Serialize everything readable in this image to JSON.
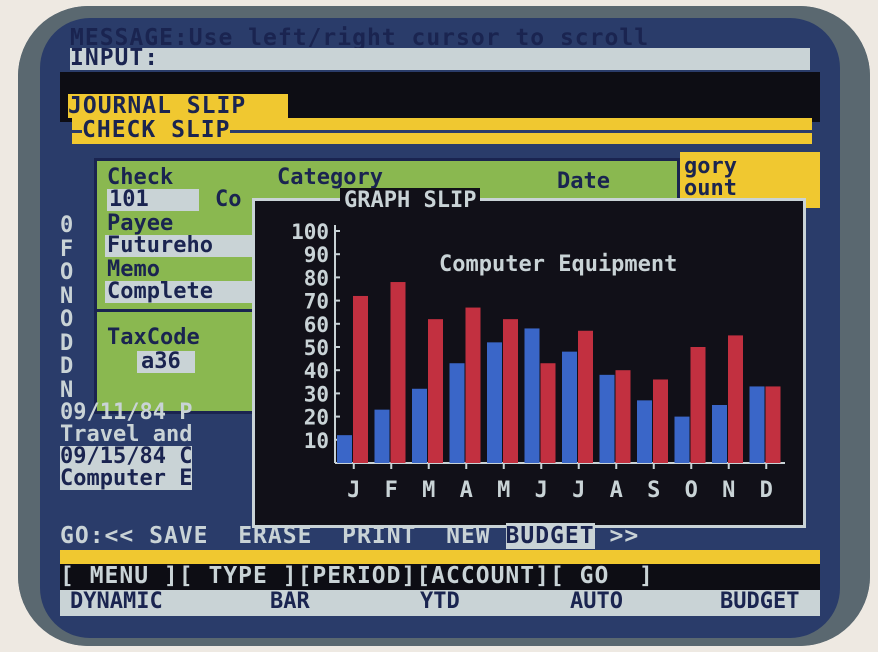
{
  "message": {
    "label": "MESSAGE:",
    "text": "Use left/right cursor to scroll"
  },
  "input": {
    "label": "INPUT:"
  },
  "journal_slip": "JOURNAL SLIP",
  "check_slip": "CHECK SLIP",
  "right_labels": [
    "gory",
    "ount"
  ],
  "check_form": {
    "check_label": "Check",
    "category_label": "Category",
    "date_label": "Date",
    "check_number": "101",
    "co_text": "Co",
    "payee_label": "Payee",
    "payee_value": "Futureho",
    "memo_label": "Memo",
    "memo_value": "Complete",
    "taxcode_label": "TaxCode",
    "taxcode_value": "a36"
  },
  "side_letters": "0FONODDN",
  "list_rows": [
    "09/11/84 P",
    "Travel and",
    "09/15/84 C",
    "Computer E"
  ],
  "graph_slip": {
    "title": "GRAPH SLIP",
    "chart_data": {
      "type": "bar",
      "title": "Computer Equipment",
      "categories": [
        "J",
        "F",
        "M",
        "A",
        "M",
        "J",
        "J",
        "A",
        "S",
        "O",
        "N",
        "D"
      ],
      "yticks": [
        10,
        20,
        30,
        40,
        50,
        60,
        70,
        80,
        90,
        100
      ],
      "ylim": [
        0,
        100
      ],
      "series": [
        {
          "values": [
            12,
            23,
            32,
            43,
            52,
            58,
            48,
            38,
            27,
            20,
            25,
            33
          ],
          "color": "#3a66c8"
        },
        {
          "values": [
            72,
            78,
            62,
            67,
            62,
            43,
            57,
            40,
            36,
            50,
            55,
            33
          ],
          "color": "#c23040"
        }
      ]
    }
  },
  "go_bar": {
    "label": "GO:",
    "arrows_left": "<<",
    "save": "SAVE",
    "erase": "ERASE",
    "print": "PRINT",
    "new": "NEW",
    "budget": "BUDGET",
    "arrows_right": ">>"
  },
  "menu_row": {
    "menu": "[ MENU ]",
    "type": "[ TYPE ]",
    "period": "[PERIOD]",
    "account": "[ACCOUNT]",
    "go": "[ GO  ]"
  },
  "values_row": {
    "menu": "DYNAMIC",
    "type": "BAR",
    "period": "YTD",
    "account": "AUTO",
    "go": "BUDGET"
  }
}
